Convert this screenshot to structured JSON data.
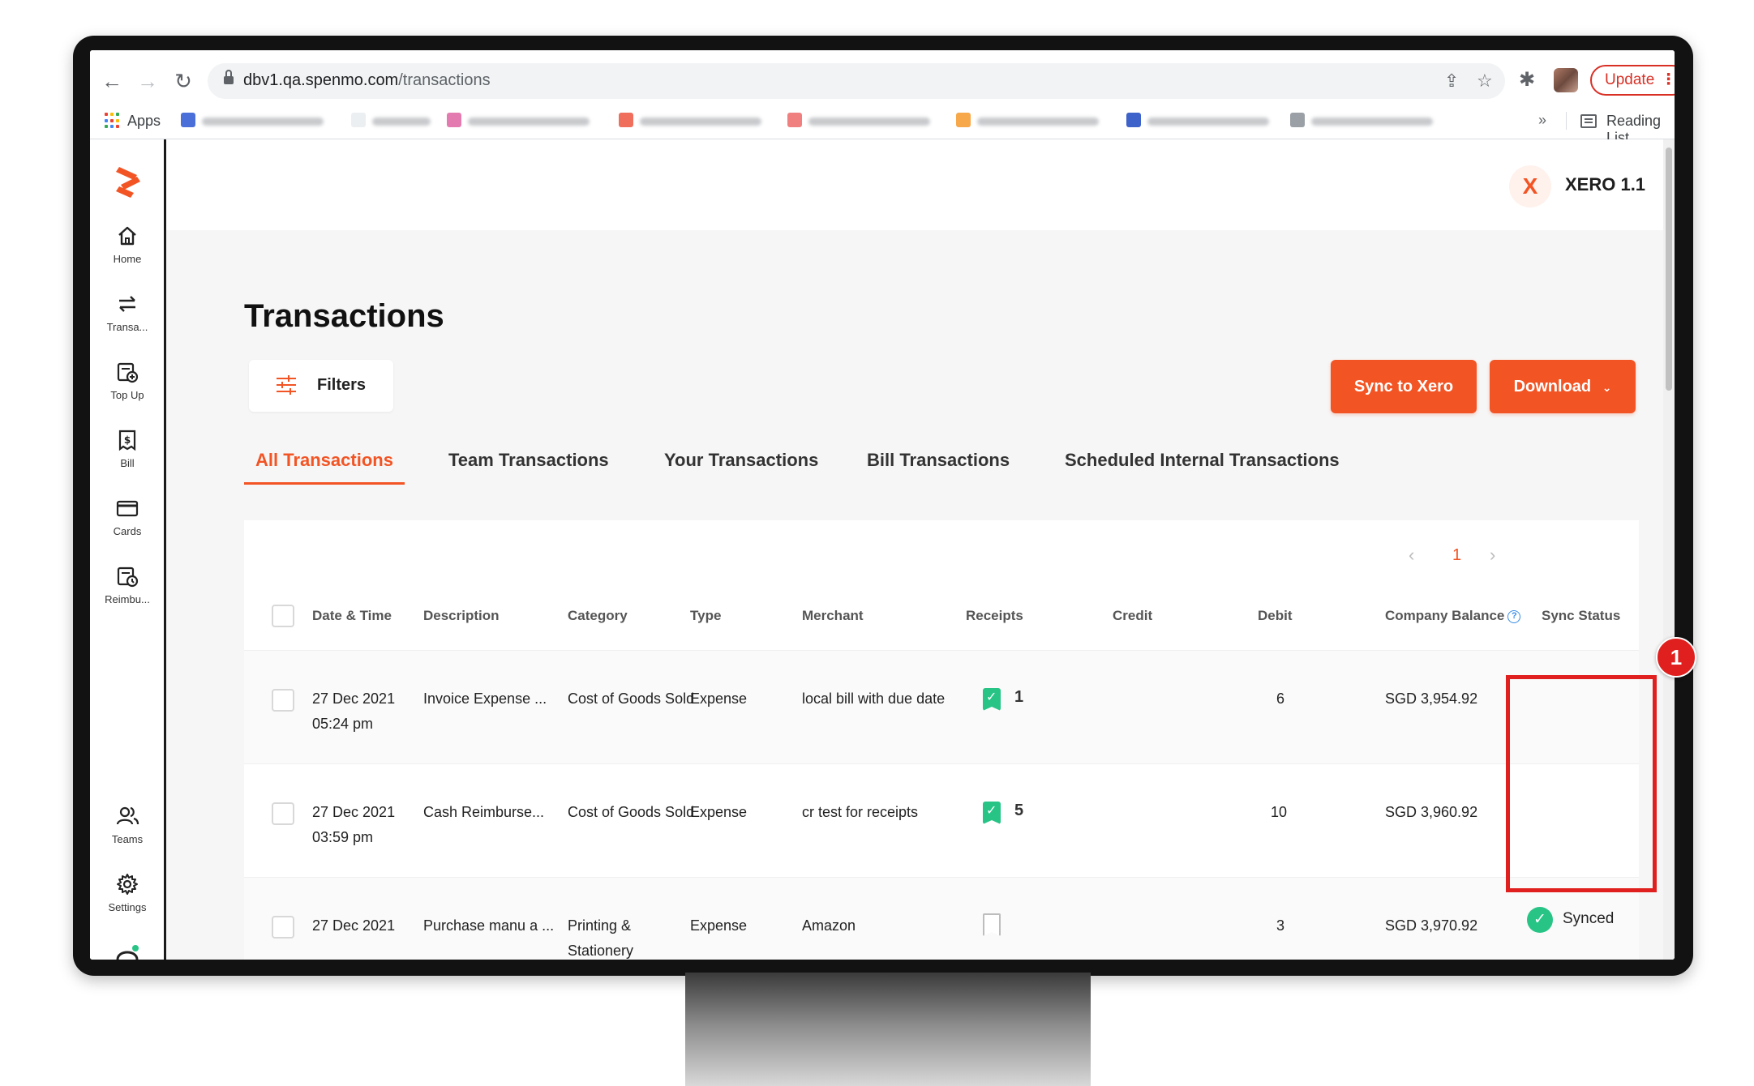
{
  "browser": {
    "url_host": "dbv1.qa.spenmo.com",
    "url_path": "/transactions",
    "update_label": "Update",
    "apps_label": "Apps",
    "more_bookmarks": "»",
    "reading_list_label": "Reading List"
  },
  "sidebar": {
    "items": [
      {
        "label": "Home",
        "icon": "home-icon"
      },
      {
        "label": "Transa...",
        "icon": "transfer-icon"
      },
      {
        "label": "Top Up",
        "icon": "topup-icon"
      },
      {
        "label": "Bill",
        "icon": "bill-icon"
      },
      {
        "label": "Cards",
        "icon": "card-icon"
      },
      {
        "label": "Reimbu...",
        "icon": "reimburse-icon"
      }
    ],
    "bottom_items": [
      {
        "label": "Teams",
        "icon": "teams-icon"
      },
      {
        "label": "Settings",
        "icon": "gear-icon"
      }
    ]
  },
  "header": {
    "org_initial": "X",
    "org_name": "XERO 1.1"
  },
  "page": {
    "title": "Transactions",
    "filters_label": "Filters",
    "sync_label": "Sync to Xero",
    "download_label": "Download"
  },
  "tabs": [
    {
      "label": "All Transactions",
      "active": true
    },
    {
      "label": "Team Transactions",
      "active": false
    },
    {
      "label": "Your Transactions",
      "active": false
    },
    {
      "label": "Bill Transactions",
      "active": false
    },
    {
      "label": "Scheduled Internal Transactions",
      "active": false
    }
  ],
  "pagination": {
    "prev": "‹",
    "current": "1",
    "next": "›"
  },
  "table": {
    "columns": [
      "Date & Time",
      "Description",
      "Category",
      "Type",
      "Merchant",
      "Receipts",
      "Credit",
      "Debit",
      "Company Balance",
      "Sync Status"
    ],
    "rows": [
      {
        "date": "27 Dec 2021",
        "time": "05:24 pm",
        "description": "Invoice Expense ...",
        "category": "Cost of Goods Sold",
        "type": "Expense",
        "merchant": "local bill with due date",
        "receipts": "1",
        "credit": "",
        "debit": "6",
        "balance": "SGD 3,954.92",
        "sync_status": ""
      },
      {
        "date": "27 Dec 2021",
        "time": "03:59 pm",
        "description": "Cash Reimburse...",
        "category": "Cost of Goods Sold",
        "type": "Expense",
        "merchant": "cr test for receipts",
        "receipts": "5",
        "credit": "",
        "debit": "10",
        "balance": "SGD 3,960.92",
        "sync_status": ""
      },
      {
        "date": "27 Dec 2021",
        "time": "",
        "description": "Purchase manu a ...",
        "category": "Printing & Stationery",
        "type": "Expense",
        "merchant": "Amazon",
        "receipts": "",
        "credit": "",
        "debit": "3",
        "balance": "SGD 3,970.92",
        "sync_status": "Synced"
      }
    ]
  },
  "annotation": {
    "step": "1"
  },
  "colors": {
    "brand": "#f25424",
    "success": "#27c486",
    "annotation": "#e0201f"
  }
}
